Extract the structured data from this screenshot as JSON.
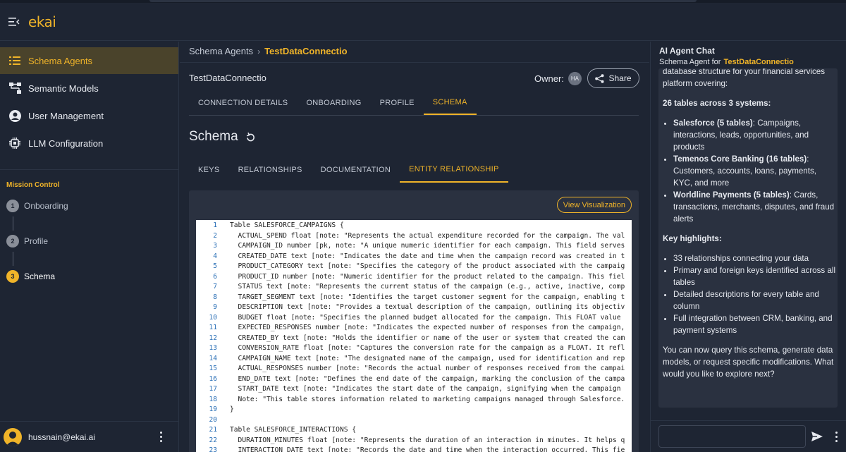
{
  "app": {
    "logo_text": "ekai"
  },
  "sidebar": {
    "items": [
      {
        "label": "Schema Agents",
        "icon": "list-icon",
        "active": true
      },
      {
        "label": "Semantic Models",
        "icon": "hierarchy-icon",
        "active": false
      },
      {
        "label": "User Management",
        "icon": "user-circle-icon",
        "active": false
      },
      {
        "label": "LLM Configuration",
        "icon": "chip-icon",
        "active": false
      }
    ],
    "mission_control": {
      "title": "Mission Control",
      "steps": [
        {
          "number": "1",
          "label": "Onboarding",
          "active": false
        },
        {
          "number": "2",
          "label": "Profile",
          "active": false
        },
        {
          "number": "3",
          "label": "Schema",
          "active": true
        }
      ]
    },
    "user": {
      "email": "hussnain@ekai.ai"
    }
  },
  "main": {
    "breadcrumb": {
      "root": "Schema Agents",
      "separator": "›",
      "current": "TestDataConnectio"
    },
    "connection_name": "TestDataConnectio",
    "owner_label": "Owner:",
    "owner_initials": "HA",
    "share_label": "Share",
    "tabs": [
      "CONNECTION DETAILS",
      "ONBOARDING",
      "PROFILE",
      "SCHEMA"
    ],
    "active_tab": "SCHEMA",
    "schema_title": "Schema",
    "subtabs": [
      "KEYS",
      "RELATIONSHIPS",
      "DOCUMENTATION",
      "ENTITY RELATIONSHIP"
    ],
    "active_subtab": "ENTITY RELATIONSHIP",
    "view_visualization_label": "View Visualization",
    "code_lines": [
      "Table SALESFORCE_CAMPAIGNS {",
      "  ACTUAL_SPEND float [note: \"Represents the actual expenditure recorded for the campaign. The val",
      "  CAMPAIGN_ID number [pk, note: \"A unique numeric identifier for each campaign. This field serves",
      "  CREATED_DATE text [note: \"Indicates the date and time when the campaign record was created in t",
      "  PRODUCT_CATEGORY text [note: \"Specifies the category of the product associated with the campaig",
      "  PRODUCT_ID number [note: \"Numeric identifier for the product related to the campaign. This fiel",
      "  STATUS text [note: \"Represents the current status of the campaign (e.g., active, inactive, comp",
      "  TARGET_SEGMENT text [note: \"Identifies the target customer segment for the campaign, enabling t",
      "  DESCRIPTION text [note: \"Provides a textual description of the campaign, outlining its objectiv",
      "  BUDGET float [note: \"Specifies the planned budget allocated for the campaign. This FLOAT value",
      "  EXPECTED_RESPONSES number [note: \"Indicates the expected number of responses from the campaign,",
      "  CREATED_BY text [note: \"Holds the identifier or name of the user or system that created the cam",
      "  CONVERSION_RATE float [note: \"Captures the conversion rate for the campaign as a FLOAT. It refl",
      "  CAMPAIGN_NAME text [note: \"The designated name of the campaign, used for identification and rep",
      "  ACTUAL_RESPONSES number [note: \"Records the actual number of responses received from the campai",
      "  END_DATE text [note: \"Defines the end date of the campaign, marking the conclusion of the campa",
      "  START_DATE text [note: \"Indicates the start date of the campaign, signifying when the campaign",
      "  Note: \"This table stores information related to marketing campaigns managed through Salesforce.",
      "}",
      "",
      "Table SALESFORCE_INTERACTIONS {",
      "  DURATION_MINUTES float [note: \"Represents the duration of an interaction in minutes. It helps q",
      "  INTERACTION_DATE text [note: \"Records the date and time when the interaction occurred. This fie"
    ]
  },
  "chat": {
    "title": "AI Agent Chat",
    "subtitle_prefix": "Schema Agent for",
    "subtitle_name": "TestDataConnectio",
    "intro": "database structure for your financial services platform covering:",
    "tables_heading": "26 tables across 3 systems:",
    "systems": [
      {
        "name": "Salesforce (5 tables)",
        "desc": ": Campaigns, interactions, leads, opportunities, and products"
      },
      {
        "name": "Temenos Core Banking (16 tables)",
        "desc": ": Customers, accounts, loans, payments, KYC, and more"
      },
      {
        "name": "Worldline Payments (5 tables)",
        "desc": ": Cards, transactions, merchants, disputes, and fraud alerts"
      }
    ],
    "highlights_heading": "Key highlights:",
    "highlights": [
      "33 relationships connecting your data",
      "Primary and foreign keys identified across all tables",
      "Detailed descriptions for every table and column",
      "Full integration between CRM, banking, and payment systems"
    ],
    "closing": "You can now query this schema, generate data models, or request specific modifications. What would you like to explore next?",
    "input_placeholder": ""
  },
  "colors": {
    "accent": "#f0b429",
    "background": "#1e2533",
    "panel": "#2a3140"
  }
}
